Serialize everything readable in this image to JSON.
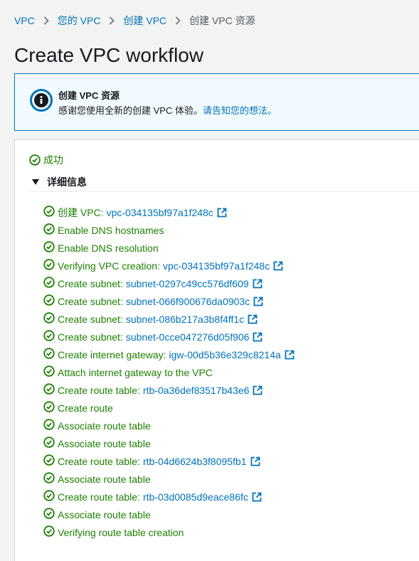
{
  "breadcrumb": {
    "items": [
      "VPC",
      "您的 VPC",
      "创建 VPC"
    ],
    "current": "创建 VPC 资源"
  },
  "title": "Create VPC workflow",
  "info": {
    "title": "创建 VPC 资源",
    "text": "感谢您使用全新的创建 VPC 体验。",
    "link": "请告知您的想法。"
  },
  "status": "成功",
  "details_label": "详细信息",
  "colors": {
    "success": "#1d8102",
    "link": "#0073bb",
    "info_border": "#0073bb"
  },
  "steps": [
    {
      "label": "创建 VPC:",
      "resource": "vpc-034135bf97a1f248c"
    },
    {
      "label": "Enable DNS hostnames",
      "resource": ""
    },
    {
      "label": "Enable DNS resolution",
      "resource": ""
    },
    {
      "label": "Verifying VPC creation:",
      "resource": "vpc-034135bf97a1f248c"
    },
    {
      "label": "Create subnet:",
      "resource": "subnet-0297c49cc576df609"
    },
    {
      "label": "Create subnet:",
      "resource": "subnet-066f900676da0903c"
    },
    {
      "label": "Create subnet:",
      "resource": "subnet-086b217a3b8f4ff1c"
    },
    {
      "label": "Create subnet:",
      "resource": "subnet-0cce047276d05f906"
    },
    {
      "label": "Create internet gateway:",
      "resource": "igw-00d5b36e329c8214a"
    },
    {
      "label": "Attach internet gateway to the VPC",
      "resource": ""
    },
    {
      "label": "Create route table:",
      "resource": "rtb-0a36def83517b43e6"
    },
    {
      "label": "Create route",
      "resource": ""
    },
    {
      "label": "Associate route table",
      "resource": ""
    },
    {
      "label": "Associate route table",
      "resource": ""
    },
    {
      "label": "Create route table:",
      "resource": "rtb-04d6624b3f8095fb1"
    },
    {
      "label": "Associate route table",
      "resource": ""
    },
    {
      "label": "Create route table:",
      "resource": "rtb-03d0085d9eace86fc"
    },
    {
      "label": "Associate route table",
      "resource": ""
    },
    {
      "label": "Verifying route table creation",
      "resource": ""
    }
  ]
}
